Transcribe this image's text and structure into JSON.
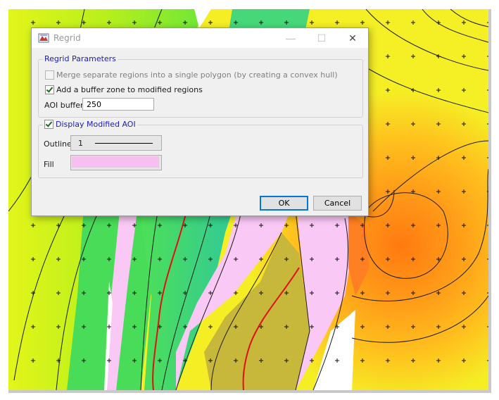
{
  "window": {
    "title": "Regrid",
    "controls": {
      "minimize": "—",
      "maximize": "☐",
      "close": "✕"
    }
  },
  "params": {
    "legend": "Regrid Parameters",
    "merge_label": "Merge separate regions into a single polygon (by creating a convex hull)",
    "merge_checked": false,
    "merge_enabled": false,
    "buffer_label": "Add a buffer zone to modified regions",
    "buffer_checked": true,
    "aoi_buffer_label": "AOI buffer",
    "aoi_buffer_value": "250"
  },
  "display": {
    "legend": "Display Modified AOI",
    "checked": true,
    "outline_label": "Outline",
    "outline_width": "1",
    "fill_label": "Fill",
    "fill_color": "#f6bff0"
  },
  "buttons": {
    "ok": "OK",
    "cancel": "Cancel"
  },
  "colors": {
    "accent_legend": "#1b1bb5",
    "map_yellow_green": "#d4f21a",
    "map_green": "#3fe25e",
    "map_teal": "#33c98e",
    "map_pink": "#fac8f5",
    "map_olive": "#c7b83c",
    "map_orange": "#ff8a1a",
    "map_yellow": "#f7f025"
  }
}
